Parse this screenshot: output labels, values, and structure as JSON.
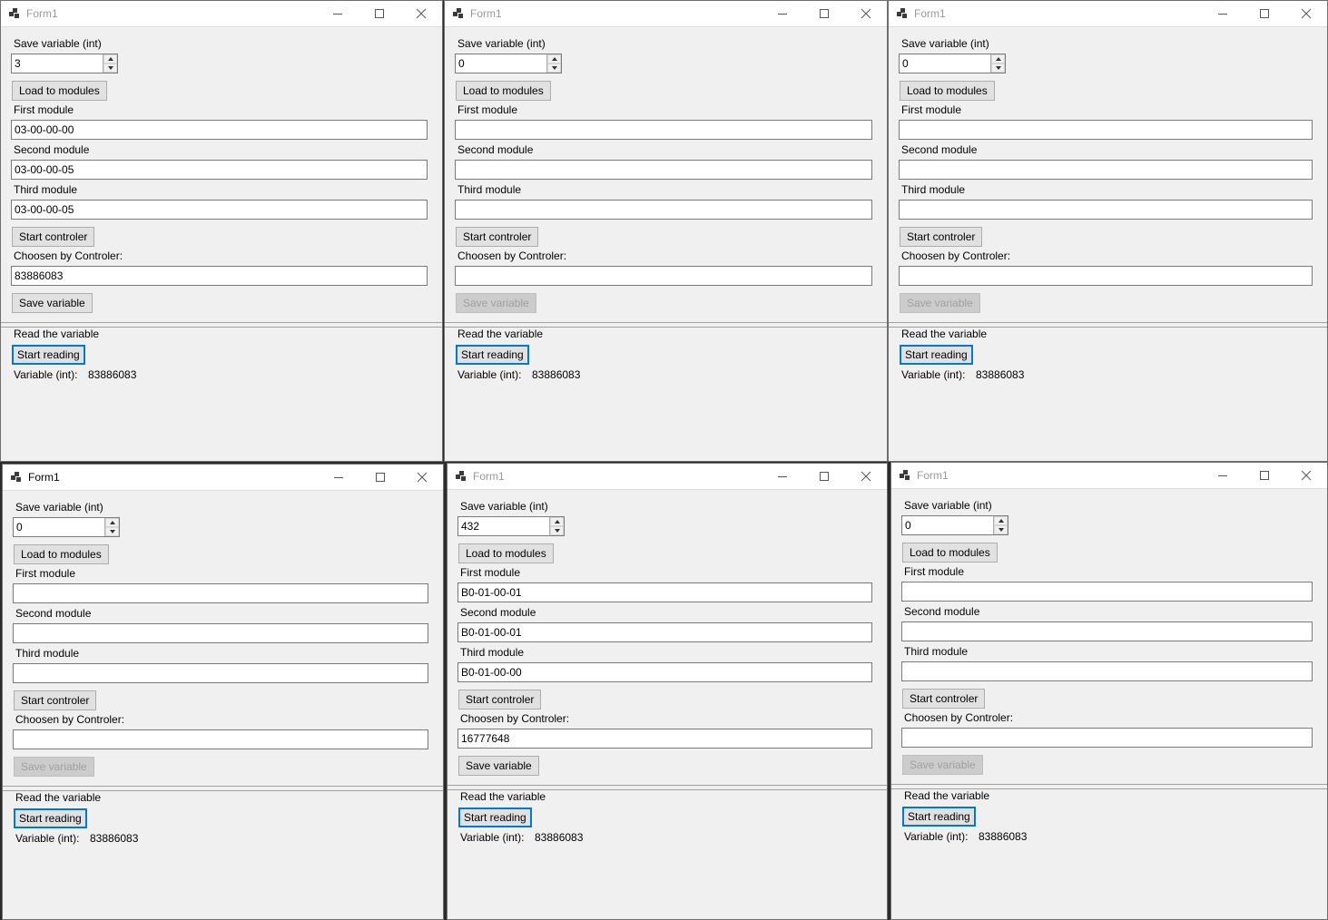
{
  "windows": [
    {
      "title": "Form1",
      "save_label": "Save variable (int)",
      "save_value": "3",
      "load_button": "Load to modules",
      "first_label": "First module",
      "first_value": "03-00-00-00",
      "second_label": "Second module",
      "second_value": "03-00-00-05",
      "third_label": "Third module",
      "third_value": "03-00-00-05",
      "start_controler_button": "Start controler",
      "choosen_label": "Choosen by Controler:",
      "choosen_value": "83886083",
      "save_button": "Save variable",
      "save_enabled": true,
      "read_label": "Read the variable",
      "start_reading_button": "Start reading",
      "variable_label": "Variable (int):",
      "variable_value": "83886083",
      "active": false
    },
    {
      "title": "Form1",
      "save_label": "Save variable (int)",
      "save_value": "0",
      "load_button": "Load to modules",
      "first_label": "First module",
      "first_value": "",
      "second_label": "Second module",
      "second_value": "",
      "third_label": "Third module",
      "third_value": "",
      "start_controler_button": "Start controler",
      "choosen_label": "Choosen by Controler:",
      "choosen_value": "",
      "save_button": "Save variable",
      "save_enabled": false,
      "read_label": "Read the variable",
      "start_reading_button": "Start reading",
      "variable_label": "Variable (int):",
      "variable_value": "83886083",
      "active": false
    },
    {
      "title": "Form1",
      "save_label": "Save variable (int)",
      "save_value": "0",
      "load_button": "Load to modules",
      "first_label": "First module",
      "first_value": "",
      "second_label": "Second module",
      "second_value": "",
      "third_label": "Third module",
      "third_value": "",
      "start_controler_button": "Start controler",
      "choosen_label": "Choosen by Controler:",
      "choosen_value": "",
      "save_button": "Save variable",
      "save_enabled": false,
      "read_label": "Read the variable",
      "start_reading_button": "Start reading",
      "variable_label": "Variable (int):",
      "variable_value": "83886083",
      "active": false
    },
    {
      "title": "Form1",
      "save_label": "Save variable (int)",
      "save_value": "0",
      "load_button": "Load to modules",
      "first_label": "First module",
      "first_value": "",
      "second_label": "Second module",
      "second_value": "",
      "third_label": "Third module",
      "third_value": "",
      "start_controler_button": "Start controler",
      "choosen_label": "Choosen by Controler:",
      "choosen_value": "",
      "save_button": "Save variable",
      "save_enabled": false,
      "read_label": "Read the variable",
      "start_reading_button": "Start reading",
      "variable_label": "Variable (int):",
      "variable_value": "83886083",
      "active": true
    },
    {
      "title": "Form1",
      "save_label": "Save variable (int)",
      "save_value": "432",
      "load_button": "Load to modules",
      "first_label": "First module",
      "first_value": "B0-01-00-01",
      "second_label": "Second module",
      "second_value": "B0-01-00-01",
      "third_label": "Third module",
      "third_value": "B0-01-00-00",
      "start_controler_button": "Start controler",
      "choosen_label": "Choosen by Controler:",
      "choosen_value": "16777648",
      "save_button": "Save variable",
      "save_enabled": true,
      "read_label": "Read the variable",
      "start_reading_button": "Start reading",
      "variable_label": "Variable (int):",
      "variable_value": "83886083",
      "active": false
    },
    {
      "title": "Form1",
      "save_label": "Save variable (int)",
      "save_value": "0",
      "load_button": "Load to modules",
      "first_label": "First module",
      "first_value": "",
      "second_label": "Second module",
      "second_value": "",
      "third_label": "Third module",
      "third_value": "",
      "start_controler_button": "Start controler",
      "choosen_label": "Choosen by Controler:",
      "choosen_value": "",
      "save_button": "Save variable",
      "save_enabled": false,
      "read_label": "Read the variable",
      "start_reading_button": "Start reading",
      "variable_label": "Variable (int):",
      "variable_value": "83886083",
      "active": false
    }
  ]
}
